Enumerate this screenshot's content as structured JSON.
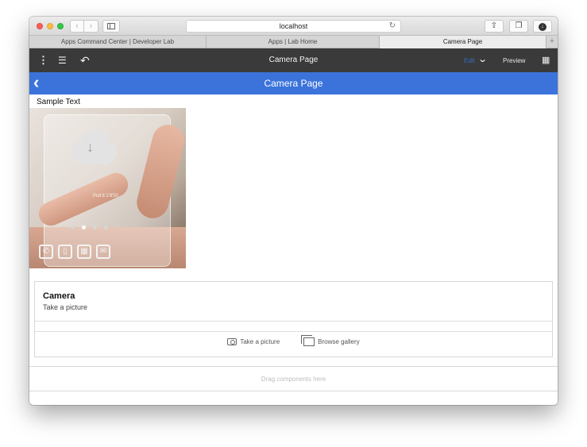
{
  "browser": {
    "url": "localhost",
    "tabs": [
      {
        "label": "Apps Command Center | Developer Lab",
        "active": false
      },
      {
        "label": "Apps | Lab Home",
        "active": false
      },
      {
        "label": "Camera Page",
        "active": true
      }
    ],
    "new_tab": "+"
  },
  "toolbar": {
    "title": "Camera Page",
    "edit_label": "Edit",
    "preview_label": "Preview"
  },
  "header": {
    "title": "Camera Page",
    "back_symbol": "‹"
  },
  "content": {
    "sample_text": "Sample Text",
    "hero_image": {
      "screen_label": "Pull tl 1'8'50",
      "page_dots": 4,
      "active_dot": 1
    },
    "camera_card": {
      "title": "Camera",
      "subtitle": "Take a picture",
      "actions": [
        {
          "label": "Take a picture",
          "icon": "camera-icon"
        },
        {
          "label": "Browse gallery",
          "icon": "gallery-icon"
        }
      ]
    },
    "dropzone_text": "Drag components here"
  },
  "colors": {
    "toolbar_bg": "#3a3a3a",
    "header_blue": "#3b73db",
    "edit_blue": "#2f6fc0"
  }
}
